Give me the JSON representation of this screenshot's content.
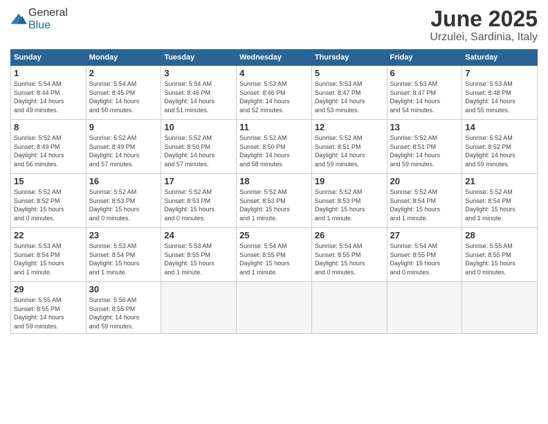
{
  "logo": {
    "general": "General",
    "blue": "Blue"
  },
  "title": "June 2025",
  "location": "Urzulei, Sardinia, Italy",
  "weekdays": [
    "Sunday",
    "Monday",
    "Tuesday",
    "Wednesday",
    "Thursday",
    "Friday",
    "Saturday"
  ],
  "weeks": [
    [
      {
        "day": "1",
        "info": "Sunrise: 5:54 AM\nSunset: 8:44 PM\nDaylight: 14 hours\nand 49 minutes."
      },
      {
        "day": "2",
        "info": "Sunrise: 5:54 AM\nSunset: 8:45 PM\nDaylight: 14 hours\nand 50 minutes."
      },
      {
        "day": "3",
        "info": "Sunrise: 5:54 AM\nSunset: 8:46 PM\nDaylight: 14 hours\nand 51 minutes."
      },
      {
        "day": "4",
        "info": "Sunrise: 5:53 AM\nSunset: 8:46 PM\nDaylight: 14 hours\nand 52 minutes."
      },
      {
        "day": "5",
        "info": "Sunrise: 5:53 AM\nSunset: 8:47 PM\nDaylight: 14 hours\nand 53 minutes."
      },
      {
        "day": "6",
        "info": "Sunrise: 5:53 AM\nSunset: 8:47 PM\nDaylight: 14 hours\nand 54 minutes."
      },
      {
        "day": "7",
        "info": "Sunrise: 5:53 AM\nSunset: 8:48 PM\nDaylight: 14 hours\nand 55 minutes."
      }
    ],
    [
      {
        "day": "8",
        "info": "Sunrise: 5:52 AM\nSunset: 8:49 PM\nDaylight: 14 hours\nand 56 minutes."
      },
      {
        "day": "9",
        "info": "Sunrise: 5:52 AM\nSunset: 8:49 PM\nDaylight: 14 hours\nand 57 minutes."
      },
      {
        "day": "10",
        "info": "Sunrise: 5:52 AM\nSunset: 8:50 PM\nDaylight: 14 hours\nand 57 minutes."
      },
      {
        "day": "11",
        "info": "Sunrise: 5:52 AM\nSunset: 8:50 PM\nDaylight: 14 hours\nand 58 minutes."
      },
      {
        "day": "12",
        "info": "Sunrise: 5:52 AM\nSunset: 8:51 PM\nDaylight: 14 hours\nand 59 minutes."
      },
      {
        "day": "13",
        "info": "Sunrise: 5:52 AM\nSunset: 8:51 PM\nDaylight: 14 hours\nand 59 minutes."
      },
      {
        "day": "14",
        "info": "Sunrise: 5:52 AM\nSunset: 8:52 PM\nDaylight: 14 hours\nand 59 minutes."
      }
    ],
    [
      {
        "day": "15",
        "info": "Sunrise: 5:52 AM\nSunset: 8:52 PM\nDaylight: 15 hours\nand 0 minutes."
      },
      {
        "day": "16",
        "info": "Sunrise: 5:52 AM\nSunset: 8:53 PM\nDaylight: 15 hours\nand 0 minutes."
      },
      {
        "day": "17",
        "info": "Sunrise: 5:52 AM\nSunset: 8:53 PM\nDaylight: 15 hours\nand 0 minutes."
      },
      {
        "day": "18",
        "info": "Sunrise: 5:52 AM\nSunset: 8:53 PM\nDaylight: 15 hours\nand 1 minute."
      },
      {
        "day": "19",
        "info": "Sunrise: 5:52 AM\nSunset: 8:53 PM\nDaylight: 15 hours\nand 1 minute."
      },
      {
        "day": "20",
        "info": "Sunrise: 5:52 AM\nSunset: 8:54 PM\nDaylight: 15 hours\nand 1 minute."
      },
      {
        "day": "21",
        "info": "Sunrise: 5:52 AM\nSunset: 8:54 PM\nDaylight: 15 hours\nand 1 minute."
      }
    ],
    [
      {
        "day": "22",
        "info": "Sunrise: 5:53 AM\nSunset: 8:54 PM\nDaylight: 15 hours\nand 1 minute."
      },
      {
        "day": "23",
        "info": "Sunrise: 5:53 AM\nSunset: 8:54 PM\nDaylight: 15 hours\nand 1 minute."
      },
      {
        "day": "24",
        "info": "Sunrise: 5:53 AM\nSunset: 8:55 PM\nDaylight: 15 hours\nand 1 minute."
      },
      {
        "day": "25",
        "info": "Sunrise: 5:54 AM\nSunset: 8:55 PM\nDaylight: 15 hours\nand 1 minute."
      },
      {
        "day": "26",
        "info": "Sunrise: 5:54 AM\nSunset: 8:55 PM\nDaylight: 15 hours\nand 0 minutes."
      },
      {
        "day": "27",
        "info": "Sunrise: 5:54 AM\nSunset: 8:55 PM\nDaylight: 15 hours\nand 0 minutes."
      },
      {
        "day": "28",
        "info": "Sunrise: 5:55 AM\nSunset: 8:55 PM\nDaylight: 15 hours\nand 0 minutes."
      }
    ],
    [
      {
        "day": "29",
        "info": "Sunrise: 5:55 AM\nSunset: 8:55 PM\nDaylight: 14 hours\nand 59 minutes."
      },
      {
        "day": "30",
        "info": "Sunrise: 5:56 AM\nSunset: 8:55 PM\nDaylight: 14 hours\nand 59 minutes."
      },
      {
        "day": "",
        "info": ""
      },
      {
        "day": "",
        "info": ""
      },
      {
        "day": "",
        "info": ""
      },
      {
        "day": "",
        "info": ""
      },
      {
        "day": "",
        "info": ""
      }
    ]
  ]
}
